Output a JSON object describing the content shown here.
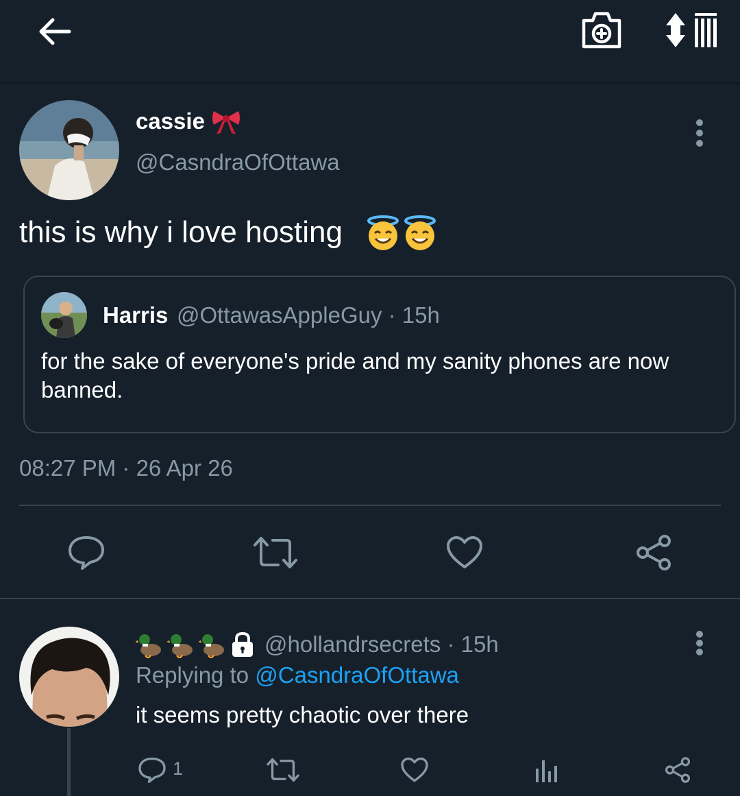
{
  "header": {
    "back_icon": "arrow-left-icon",
    "camera_icon": "camera-plus-icon",
    "sort_icon": "sort-list-icon"
  },
  "tweet": {
    "display_name": "cassie",
    "name_emoji": "bow-emoji",
    "handle": "@CasndraOfOttawa",
    "text": "this is why i love hosting",
    "emojis": [
      "halo-face-emoji",
      "halo-face-emoji"
    ],
    "timestamp": "08:27 PM · 26 Apr 26",
    "quote": {
      "name": "Harris",
      "meta": "@OttawasAppleGuy · 15h",
      "text": "for the sake of everyone's pride and my sanity phones are now banned."
    },
    "actions": [
      "reply-icon",
      "retweet-icon",
      "like-icon",
      "share-icon"
    ]
  },
  "reply": {
    "handle_meta": "@hollandrsecrets · 15h",
    "name_emojis": [
      "duck-emoji",
      "duck-emoji",
      "duck-emoji"
    ],
    "protected_icon": "lock-icon",
    "replying_prefix": "Replying to",
    "replying_link": "@CasndraOfOttawa",
    "text": "it seems pretty chaotic over there",
    "reply_count": "1",
    "actions": [
      "reply-icon",
      "retweet-icon",
      "like-icon",
      "analytics-icon",
      "share-icon"
    ]
  },
  "colors": {
    "background": "#15202b",
    "secondary_text": "#8899a6",
    "link": "#1da1f2",
    "border": "#38444d"
  }
}
